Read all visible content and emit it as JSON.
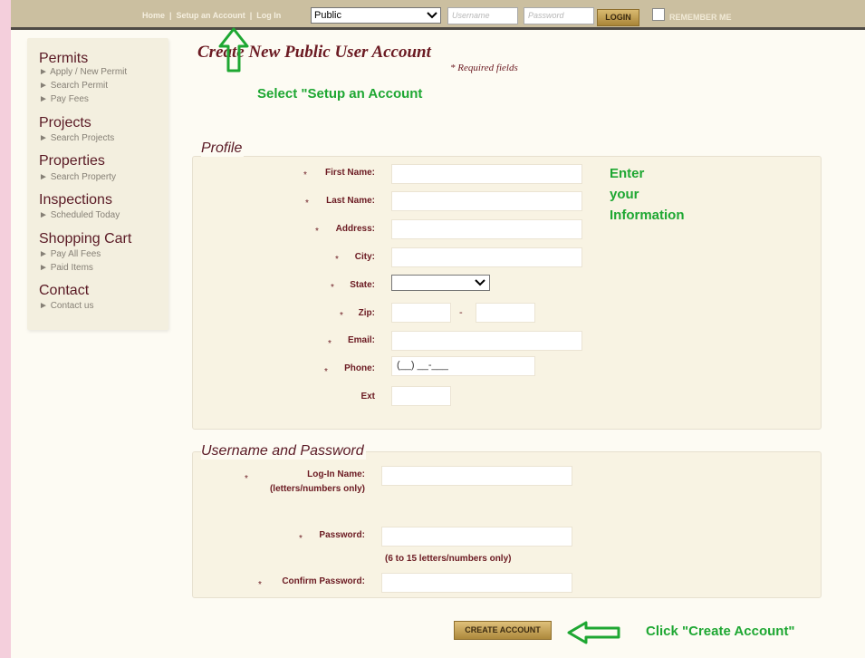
{
  "topbar": {
    "nav": [
      "Home",
      "Setup an Account",
      "Log In"
    ],
    "account_type": "Public",
    "username_placeholder": "Username",
    "password_placeholder": "Password",
    "login_label": "LOGIN",
    "remember_label": "REMEMBER ME"
  },
  "sidebar": {
    "sections": [
      {
        "title": "Permits",
        "items": [
          "Apply / New Permit",
          "Search Permit",
          "Pay Fees"
        ]
      },
      {
        "title": "Projects",
        "items": [
          "Search Projects"
        ]
      },
      {
        "title": "Properties",
        "items": [
          "Search Property"
        ]
      },
      {
        "title": "Inspections",
        "items": [
          "Scheduled Today"
        ]
      },
      {
        "title": "Shopping Cart",
        "items": [
          "Pay All Fees",
          "Paid Items"
        ]
      },
      {
        "title": "Contact",
        "items": [
          "Contact us"
        ]
      }
    ]
  },
  "main": {
    "title": "Create New Public User Account",
    "required_note": "* Required fields",
    "profile_legend": "Profile",
    "profile_fields": {
      "first_name": "First Name:",
      "last_name": "Last Name:",
      "address": "Address:",
      "city": "City:",
      "state": "State:",
      "zip": "Zip:",
      "zip_sep": "-",
      "email": "Email:",
      "phone": "Phone:",
      "phone_mask": "(__) __-___",
      "ext": "Ext"
    },
    "credentials_legend": "Username and Password",
    "credentials": {
      "login_name": "Log-In Name:",
      "login_name_hint": "(letters/numbers only)",
      "password": "Password:",
      "password_hint": "(6 to 15 letters/numbers only)",
      "confirm_password": "Confirm Password:"
    },
    "required_star": "*",
    "create_button": "CREATE ACCOUNT"
  },
  "annotations": {
    "setup_hint": "Select \"Setup an Account",
    "enter_hint": [
      "Enter",
      "your",
      "Information"
    ],
    "click_hint": "Click \"Create Account\""
  },
  "colors": {
    "annotation_green": "#1ea732",
    "label_maroon": "#6b1a22",
    "topbar": "#cbbfa0"
  }
}
